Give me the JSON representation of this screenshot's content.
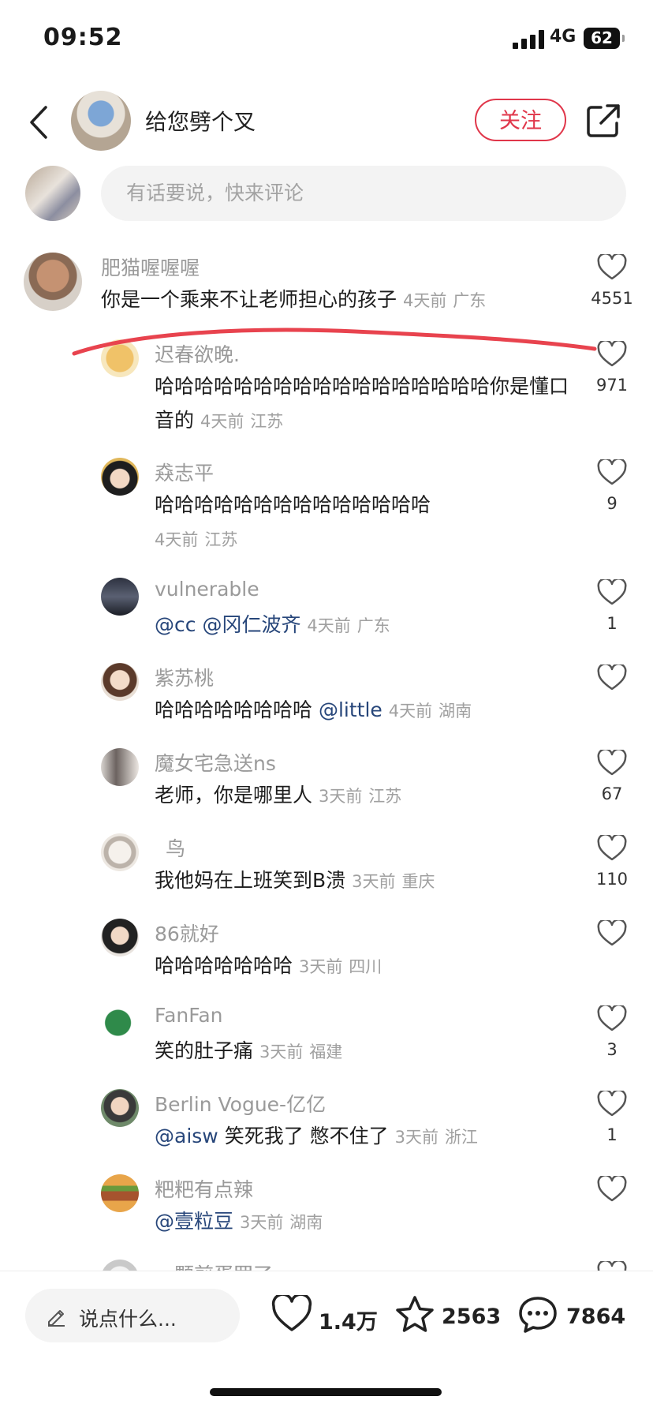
{
  "status_bar": {
    "time": "09:52",
    "network": "4G",
    "battery": "62"
  },
  "header": {
    "author_name": "给您劈个叉",
    "follow_label": "关注"
  },
  "comment_input": {
    "placeholder": "有话要说，快来评论"
  },
  "comments": [
    {
      "user": "肥猫喔喔喔",
      "text": "你是一个乘来不让老师担心的孩子",
      "time": "4天前",
      "region": "广东",
      "likes": "4551"
    },
    {
      "user": "迟春欲晚.",
      "text": "哈哈哈哈哈哈哈哈哈哈哈哈哈哈哈哈哈你是懂口音的",
      "time": "4天前",
      "region": "江苏",
      "likes": "971"
    },
    {
      "user": "猋志平",
      "text": "哈哈哈哈哈哈哈哈哈哈哈哈哈哈",
      "time": "4天前",
      "region": "江苏",
      "likes": "9"
    },
    {
      "user": "vulnerable",
      "mention1": "@cc",
      "mention2": "@冈仁波齐",
      "time": "4天前",
      "region": "广东",
      "likes": "1"
    },
    {
      "user": "紫苏桃",
      "text": "哈哈哈哈哈哈哈哈",
      "mention": "@little",
      "time": "4天前",
      "region": "湖南",
      "likes": ""
    },
    {
      "user": "魔女宅急送ns",
      "text": "老师，你是哪里人",
      "time": "3天前",
      "region": "江苏",
      "likes": "67"
    },
    {
      "user": "鸟",
      "text": "我他妈在上班笑到B溃",
      "time": "3天前",
      "region": "重庆",
      "likes": "110"
    },
    {
      "user": "86就好",
      "text": "哈哈哈哈哈哈哈",
      "time": "3天前",
      "region": "四川",
      "likes": ""
    },
    {
      "user": "FanFan",
      "text": "笑的肚子痛",
      "time": "3天前",
      "region": "福建",
      "likes": "3"
    },
    {
      "user": "Berlin Vogue-亿亿",
      "mention": "@aisw",
      "text": "笑死我了 憋不住了",
      "time": "3天前",
      "region": "浙江",
      "likes": "1"
    },
    {
      "user": "粑粑有点辣",
      "mention": "@壹粒豆",
      "time": "3天前",
      "region": "湖南",
      "likes": ""
    },
    {
      "user": "一颗煎蛋罢了"
    }
  ],
  "bottom_bar": {
    "input_label": "说点什么...",
    "likes": "1.4万",
    "favorites": "2563",
    "comments": "7864"
  },
  "colors": {
    "accent": "#e0364a",
    "mention": "#27467a",
    "annotation_line": "#e8434e"
  }
}
